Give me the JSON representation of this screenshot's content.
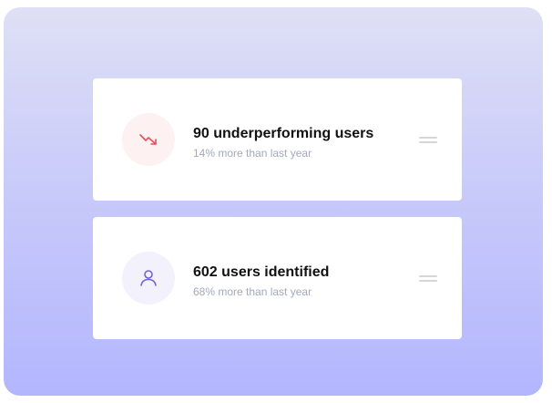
{
  "cards": [
    {
      "title": "90 underperforming users",
      "subtitle": "14% more than last year",
      "icon": "trending-down-icon",
      "icon_color": "#e8505b",
      "icon_bg": "#fdf1f2"
    },
    {
      "title": "602 users identified",
      "subtitle": "68% more than last year",
      "icon": "user-icon",
      "icon_color": "#6e63d8",
      "icon_bg": "#f3f2fc"
    }
  ],
  "colors": {
    "background_top": "#dfe0f5",
    "background_bottom": "#b3b6fe",
    "card": "#ffffff",
    "title_text": "#111111",
    "subtitle_text": "#a5a8ba",
    "drag_handle": "#d5d6dc"
  }
}
